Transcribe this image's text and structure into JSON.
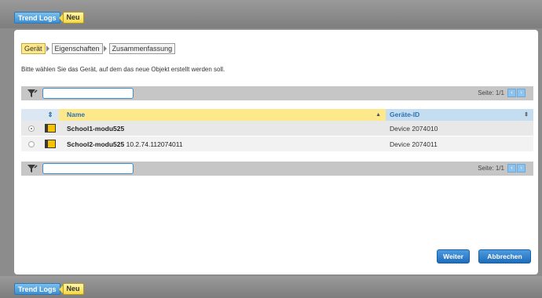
{
  "top_crumbs": {
    "trend_logs": "Trend Logs",
    "new": "Neu"
  },
  "bottom_crumbs": {
    "trend_logs": "Trend Logs",
    "new": "Neu"
  },
  "steps": [
    "Gerät",
    "Eigenschaften",
    "Zusammenfassung"
  ],
  "active_step": "Gerät",
  "instruction": "Bitte wählen Sie das Gerät, auf dem das neue Objekt erstellt werden soll.",
  "filter_top": {
    "value": "",
    "page_label": "Seite: 1/1"
  },
  "filter_bottom": {
    "value": "",
    "page_label": "Seite: 1/1"
  },
  "pager_icons": {
    "prev": "‹",
    "next": "›"
  },
  "grid": {
    "columns": {
      "name": "Name",
      "device_id": "Geräte-ID"
    },
    "rows": [
      {
        "selected": true,
        "name": "School1-modu525",
        "address": "",
        "device_id": "Device 2074010"
      },
      {
        "selected": false,
        "name": "School2-modu525",
        "address": "10.2.74.112074011",
        "device_id": "Device 2074011"
      }
    ]
  },
  "buttons": {
    "next": "Weiter",
    "cancel": "Abbrechen"
  },
  "colors": {
    "accent_blue": "#2d72b5",
    "highlight_yellow": "#fde98a",
    "device_icon": "#f5c300"
  },
  "icons": [
    "filter-icon",
    "device-icon",
    "sort-icon",
    "pager-prev-icon",
    "pager-next-icon"
  ]
}
